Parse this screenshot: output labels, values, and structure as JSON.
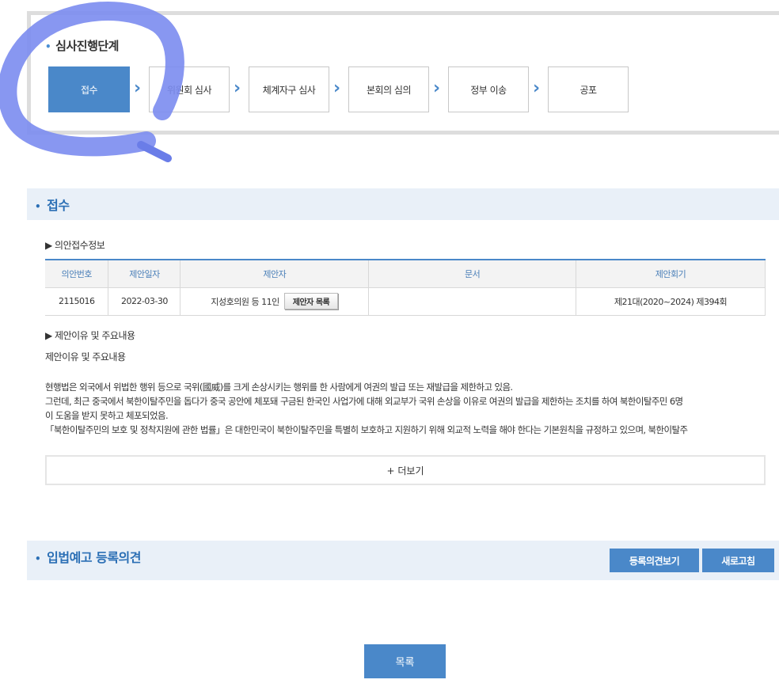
{
  "stage": {
    "title": "심사진행단계",
    "steps": [
      {
        "label": "접수",
        "active": true
      },
      {
        "label": "위원회 심사",
        "active": false
      },
      {
        "label": "체계자구 심사",
        "active": false
      },
      {
        "label": "본회의 심의",
        "active": false
      },
      {
        "label": "정부 이송",
        "active": false
      },
      {
        "label": "공포",
        "active": false
      }
    ]
  },
  "reception": {
    "title": "접수",
    "info_label": "▶ 의안접수정보",
    "table": {
      "headers": [
        "의안번호",
        "제안일자",
        "제안자",
        "문서",
        "제안회기"
      ],
      "row": {
        "bill_no": "2115016",
        "date": "2022-03-30",
        "proposer": "지성호의원 등 11인",
        "proposer_btn": "제안자 목록",
        "document": "",
        "session": "제21대(2020~2024) 제394회"
      }
    },
    "reason_label": "▶ 제안이유 및 주요내용",
    "reason_title": "제안이유 및 주요내용",
    "reason_lines": [
      "현행법은 외국에서 위법한 행위 등으로 국위(國威)를 크게 손상시키는 행위를 한 사람에게 여권의 발급 또는 재발급을 제한하고 있음.",
      "그런데, 최근 중국에서 북한이탈주민을 돕다가 중국 공안에 체포돼 구금된 한국인 사업가에 대해 외교부가 국위 손상을 이유로 여권의 발급을 제한하는 조치를 하여 북한이탈주민 6명",
      "이 도움을 받지 못하고 체포되었음.",
      "「북한이탈주민의 보호 및 정착지원에 관한 법률」은 대한민국이 북한이탈주민을 특별히 보호하고 지원하기 위해 외교적 노력을 해야 한다는 기본원칙을 규정하고 있으며, 북한이탈주"
    ],
    "more_label": "+ 더보기"
  },
  "opinion": {
    "title": "입법예고 등록의견",
    "view_btn": "등록의견보기",
    "refresh_btn": "새로고침"
  },
  "list_btn": "목록",
  "colors": {
    "accent": "#4a88c9",
    "header_bg": "#e9f0f8",
    "annotation": "#7b8cf0"
  }
}
